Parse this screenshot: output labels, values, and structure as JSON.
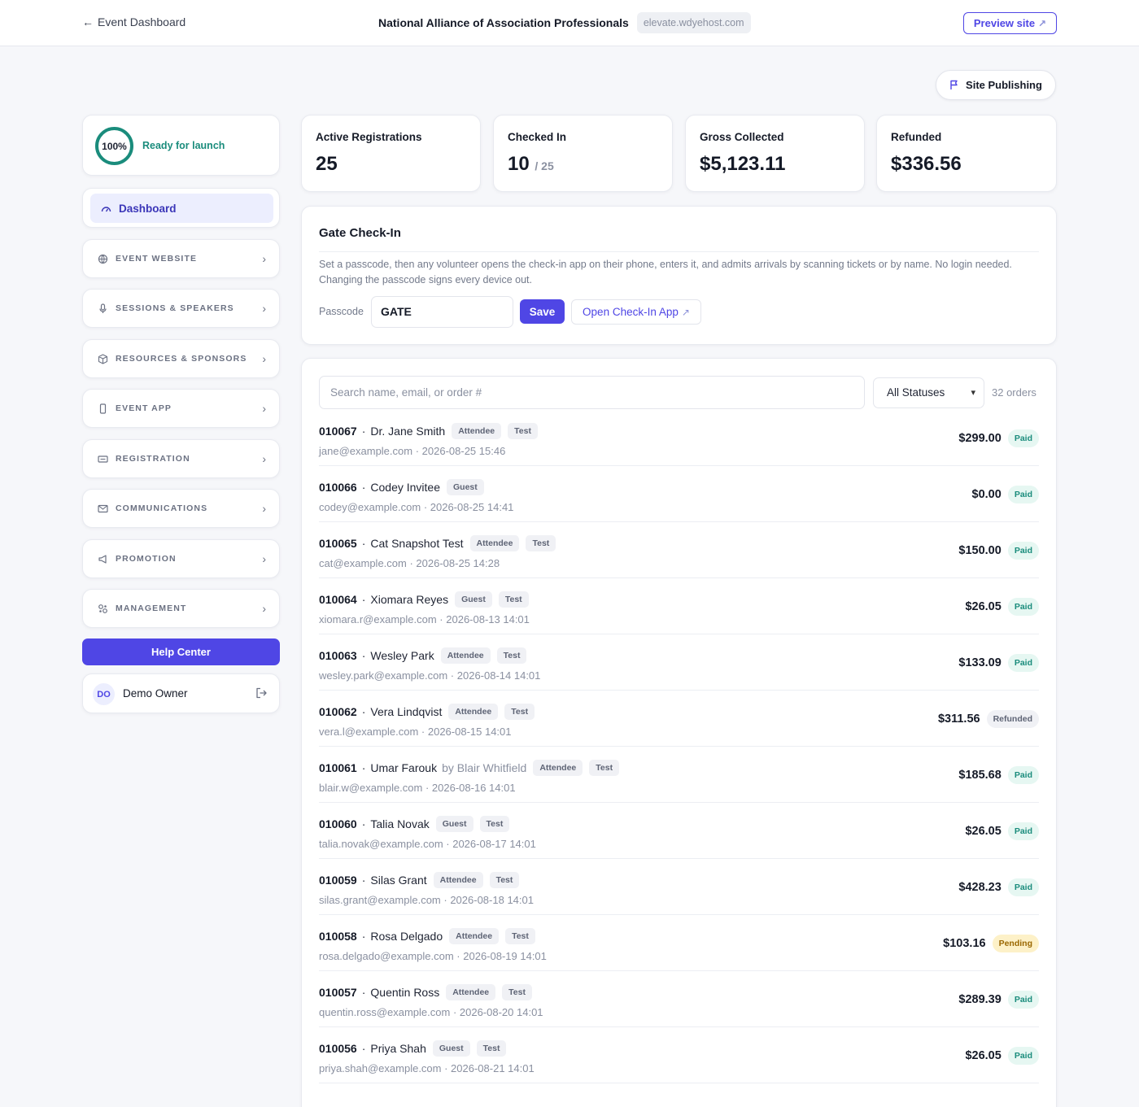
{
  "topbar": {
    "back_label": "Event Dashboard",
    "org_name": "National Alliance of Association Professionals",
    "domain": "elevate.wdyehost.com",
    "preview_label": "Preview site"
  },
  "publish_label": "Site Publishing",
  "sidebar": {
    "launch_percent": "100%",
    "launch_text": "Ready for launch",
    "dashboard_label": "Dashboard",
    "items": [
      {
        "label": "EVENT WEBSITE",
        "icon": "globe-icon"
      },
      {
        "label": "SESSIONS & SPEAKERS",
        "icon": "microphone-icon"
      },
      {
        "label": "RESOURCES & SPONSORS",
        "icon": "box-icon"
      },
      {
        "label": "EVENT APP",
        "icon": "phone-icon"
      },
      {
        "label": "REGISTRATION",
        "icon": "ticket-icon"
      },
      {
        "label": "COMMUNICATIONS",
        "icon": "mail-icon"
      },
      {
        "label": "PROMOTION",
        "icon": "megaphone-icon"
      },
      {
        "label": "MANAGEMENT",
        "icon": "gears-icon"
      }
    ],
    "help_label": "Help Center",
    "owner_initials": "DO",
    "owner_name": "Demo Owner"
  },
  "stats": [
    {
      "label": "Active Registrations",
      "value": "25",
      "sub": ""
    },
    {
      "label": "Checked In",
      "value": "10",
      "sub": "/ 25"
    },
    {
      "label": "Gross Collected",
      "value": "$5,123.11",
      "sub": ""
    },
    {
      "label": "Refunded",
      "value": "$336.56",
      "sub": ""
    }
  ],
  "gate": {
    "title": "Gate Check-In",
    "description": "Set a passcode, then any volunteer opens the check-in app on their phone, enters it, and admits arrivals by scanning tickets or by name. No login needed. Changing the passcode signs every device out.",
    "passcode_label": "Passcode",
    "passcode_value": "GATE",
    "save_label": "Save",
    "open_app_label": "Open Check-In App"
  },
  "orders": {
    "search_placeholder": "Search name, email, or order #",
    "status_filter": "All Statuses",
    "count_label": "32 orders",
    "rows": [
      {
        "id": "010067",
        "name": "Dr. Jane Smith",
        "buyer": "",
        "tags": [
          "Attendee",
          "Test"
        ],
        "email": "jane@example.com",
        "date": "2026-08-25 15:46",
        "amount": "$299.00",
        "status": "Paid",
        "status_kind": "paid"
      },
      {
        "id": "010066",
        "name": "Codey Invitee",
        "buyer": "",
        "tags": [
          "Guest"
        ],
        "email": "codey@example.com",
        "date": "2026-08-25 14:41",
        "amount": "$0.00",
        "status": "Paid",
        "status_kind": "paid"
      },
      {
        "id": "010065",
        "name": "Cat Snapshot Test",
        "buyer": "",
        "tags": [
          "Attendee",
          "Test"
        ],
        "email": "cat@example.com",
        "date": "2026-08-25 14:28",
        "amount": "$150.00",
        "status": "Paid",
        "status_kind": "paid"
      },
      {
        "id": "010064",
        "name": "Xiomara Reyes",
        "buyer": "",
        "tags": [
          "Guest",
          "Test"
        ],
        "email": "xiomara.r@example.com",
        "date": "2026-08-13 14:01",
        "amount": "$26.05",
        "status": "Paid",
        "status_kind": "paid"
      },
      {
        "id": "010063",
        "name": "Wesley Park",
        "buyer": "",
        "tags": [
          "Attendee",
          "Test"
        ],
        "email": "wesley.park@example.com",
        "date": "2026-08-14 14:01",
        "amount": "$133.09",
        "status": "Paid",
        "status_kind": "paid"
      },
      {
        "id": "010062",
        "name": "Vera Lindqvist",
        "buyer": "",
        "tags": [
          "Attendee",
          "Test"
        ],
        "email": "vera.l@example.com",
        "date": "2026-08-15 14:01",
        "amount": "$311.56",
        "status": "Refunded",
        "status_kind": "refunded"
      },
      {
        "id": "010061",
        "name": "Umar Farouk",
        "buyer": "by Blair Whitfield",
        "tags": [
          "Attendee",
          "Test"
        ],
        "email": "blair.w@example.com",
        "date": "2026-08-16 14:01",
        "amount": "$185.68",
        "status": "Paid",
        "status_kind": "paid"
      },
      {
        "id": "010060",
        "name": "Talia Novak",
        "buyer": "",
        "tags": [
          "Guest",
          "Test"
        ],
        "email": "talia.novak@example.com",
        "date": "2026-08-17 14:01",
        "amount": "$26.05",
        "status": "Paid",
        "status_kind": "paid"
      },
      {
        "id": "010059",
        "name": "Silas Grant",
        "buyer": "",
        "tags": [
          "Attendee",
          "Test"
        ],
        "email": "silas.grant@example.com",
        "date": "2026-08-18 14:01",
        "amount": "$428.23",
        "status": "Paid",
        "status_kind": "paid"
      },
      {
        "id": "010058",
        "name": "Rosa Delgado",
        "buyer": "",
        "tags": [
          "Attendee",
          "Test"
        ],
        "email": "rosa.delgado@example.com",
        "date": "2026-08-19 14:01",
        "amount": "$103.16",
        "status": "Pending",
        "status_kind": "pending"
      },
      {
        "id": "010057",
        "name": "Quentin Ross",
        "buyer": "",
        "tags": [
          "Attendee",
          "Test"
        ],
        "email": "quentin.ross@example.com",
        "date": "2026-08-20 14:01",
        "amount": "$289.39",
        "status": "Paid",
        "status_kind": "paid"
      },
      {
        "id": "010056",
        "name": "Priya Shah",
        "buyer": "",
        "tags": [
          "Guest",
          "Test"
        ],
        "email": "priya.shah@example.com",
        "date": "2026-08-21 14:01",
        "amount": "$26.05",
        "status": "Paid",
        "status_kind": "paid"
      }
    ]
  },
  "colors": {
    "accent": "#4f46e5",
    "success": "#1a8c7c",
    "pending": "#9a6700"
  }
}
